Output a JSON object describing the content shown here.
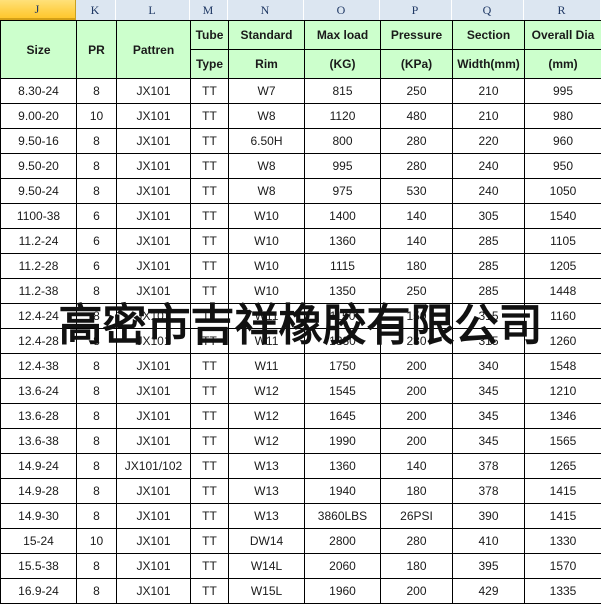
{
  "spreadsheet": {
    "column_letters": [
      "J",
      "K",
      "L",
      "M",
      "N",
      "O",
      "P",
      "Q",
      "R"
    ],
    "active_column": "J",
    "active_column_color": "#ffd24d",
    "header_fill_color": "#ccffcc",
    "column_header_fill_color": "#dce6f1",
    "grid_line_color": "#000000"
  },
  "watermark": {
    "text": "高密市吉祥橡胶有限公司",
    "color": "#111111"
  },
  "table": {
    "header_top": [
      "Size",
      "PR",
      "Pattren",
      "Tube",
      "Standard",
      "Max load",
      "Pressure",
      "Section",
      "Overall Dia"
    ],
    "header_bottom": [
      "",
      "",
      "",
      "Type",
      "Rim",
      "(KG)",
      "(KPa)",
      "Width(mm)",
      "(mm)"
    ],
    "rows": [
      [
        "8.30-24",
        "8",
        "JX101",
        "TT",
        "W7",
        "815",
        "250",
        "210",
        "995"
      ],
      [
        "9.00-20",
        "10",
        "JX101",
        "TT",
        "W8",
        "1120",
        "480",
        "210",
        "980"
      ],
      [
        "9.50-16",
        "8",
        "JX101",
        "TT",
        "6.50H",
        "800",
        "280",
        "220",
        "960"
      ],
      [
        "9.50-20",
        "8",
        "JX101",
        "TT",
        "W8",
        "995",
        "280",
        "240",
        "950"
      ],
      [
        "9.50-24",
        "8",
        "JX101",
        "TT",
        "W8",
        "975",
        "530",
        "240",
        "1050"
      ],
      [
        "1100-38",
        "6",
        "JX101",
        "TT",
        "W10",
        "1400",
        "140",
        "305",
        "1540"
      ],
      [
        "11.2-24",
        "6",
        "JX101",
        "TT",
        "W10",
        "1360",
        "140",
        "285",
        "1105"
      ],
      [
        "11.2-28",
        "6",
        "JX101",
        "TT",
        "W10",
        "1115",
        "180",
        "285",
        "1205"
      ],
      [
        "11.2-38",
        "8",
        "JX101",
        "TT",
        "W10",
        "1350",
        "250",
        "285",
        "1448"
      ],
      [
        "12.4-24",
        "8",
        "JX101",
        "TT",
        "W11",
        "1150",
        "150",
        "315",
        "1160"
      ],
      [
        "12.4-28",
        "8",
        "JX101",
        "TT",
        "W11",
        "1330",
        "230",
        "315",
        "1260"
      ],
      [
        "12.4-38",
        "8",
        "JX101",
        "TT",
        "W11",
        "1750",
        "200",
        "340",
        "1548"
      ],
      [
        "13.6-24",
        "8",
        "JX101",
        "TT",
        "W12",
        "1545",
        "200",
        "345",
        "1210"
      ],
      [
        "13.6-28",
        "8",
        "JX101",
        "TT",
        "W12",
        "1645",
        "200",
        "345",
        "1346"
      ],
      [
        "13.6-38",
        "8",
        "JX101",
        "TT",
        "W12",
        "1990",
        "200",
        "345",
        "1565"
      ],
      [
        "14.9-24",
        "8",
        "JX101/102",
        "TT",
        "W13",
        "1360",
        "140",
        "378",
        "1265"
      ],
      [
        "14.9-28",
        "8",
        "JX101",
        "TT",
        "W13",
        "1940",
        "180",
        "378",
        "1415"
      ],
      [
        "14.9-30",
        "8",
        "JX101",
        "TT",
        "W13",
        "3860LBS",
        "26PSI",
        "390",
        "1415"
      ],
      [
        "15-24",
        "10",
        "JX101",
        "TT",
        "DW14",
        "2800",
        "280",
        "410",
        "1330"
      ],
      [
        "15.5-38",
        "8",
        "JX101",
        "TT",
        "W14L",
        "2060",
        "180",
        "395",
        "1570"
      ],
      [
        "16.9-24",
        "8",
        "JX101",
        "TT",
        "W15L",
        "1960",
        "200",
        "429",
        "1335"
      ]
    ]
  }
}
